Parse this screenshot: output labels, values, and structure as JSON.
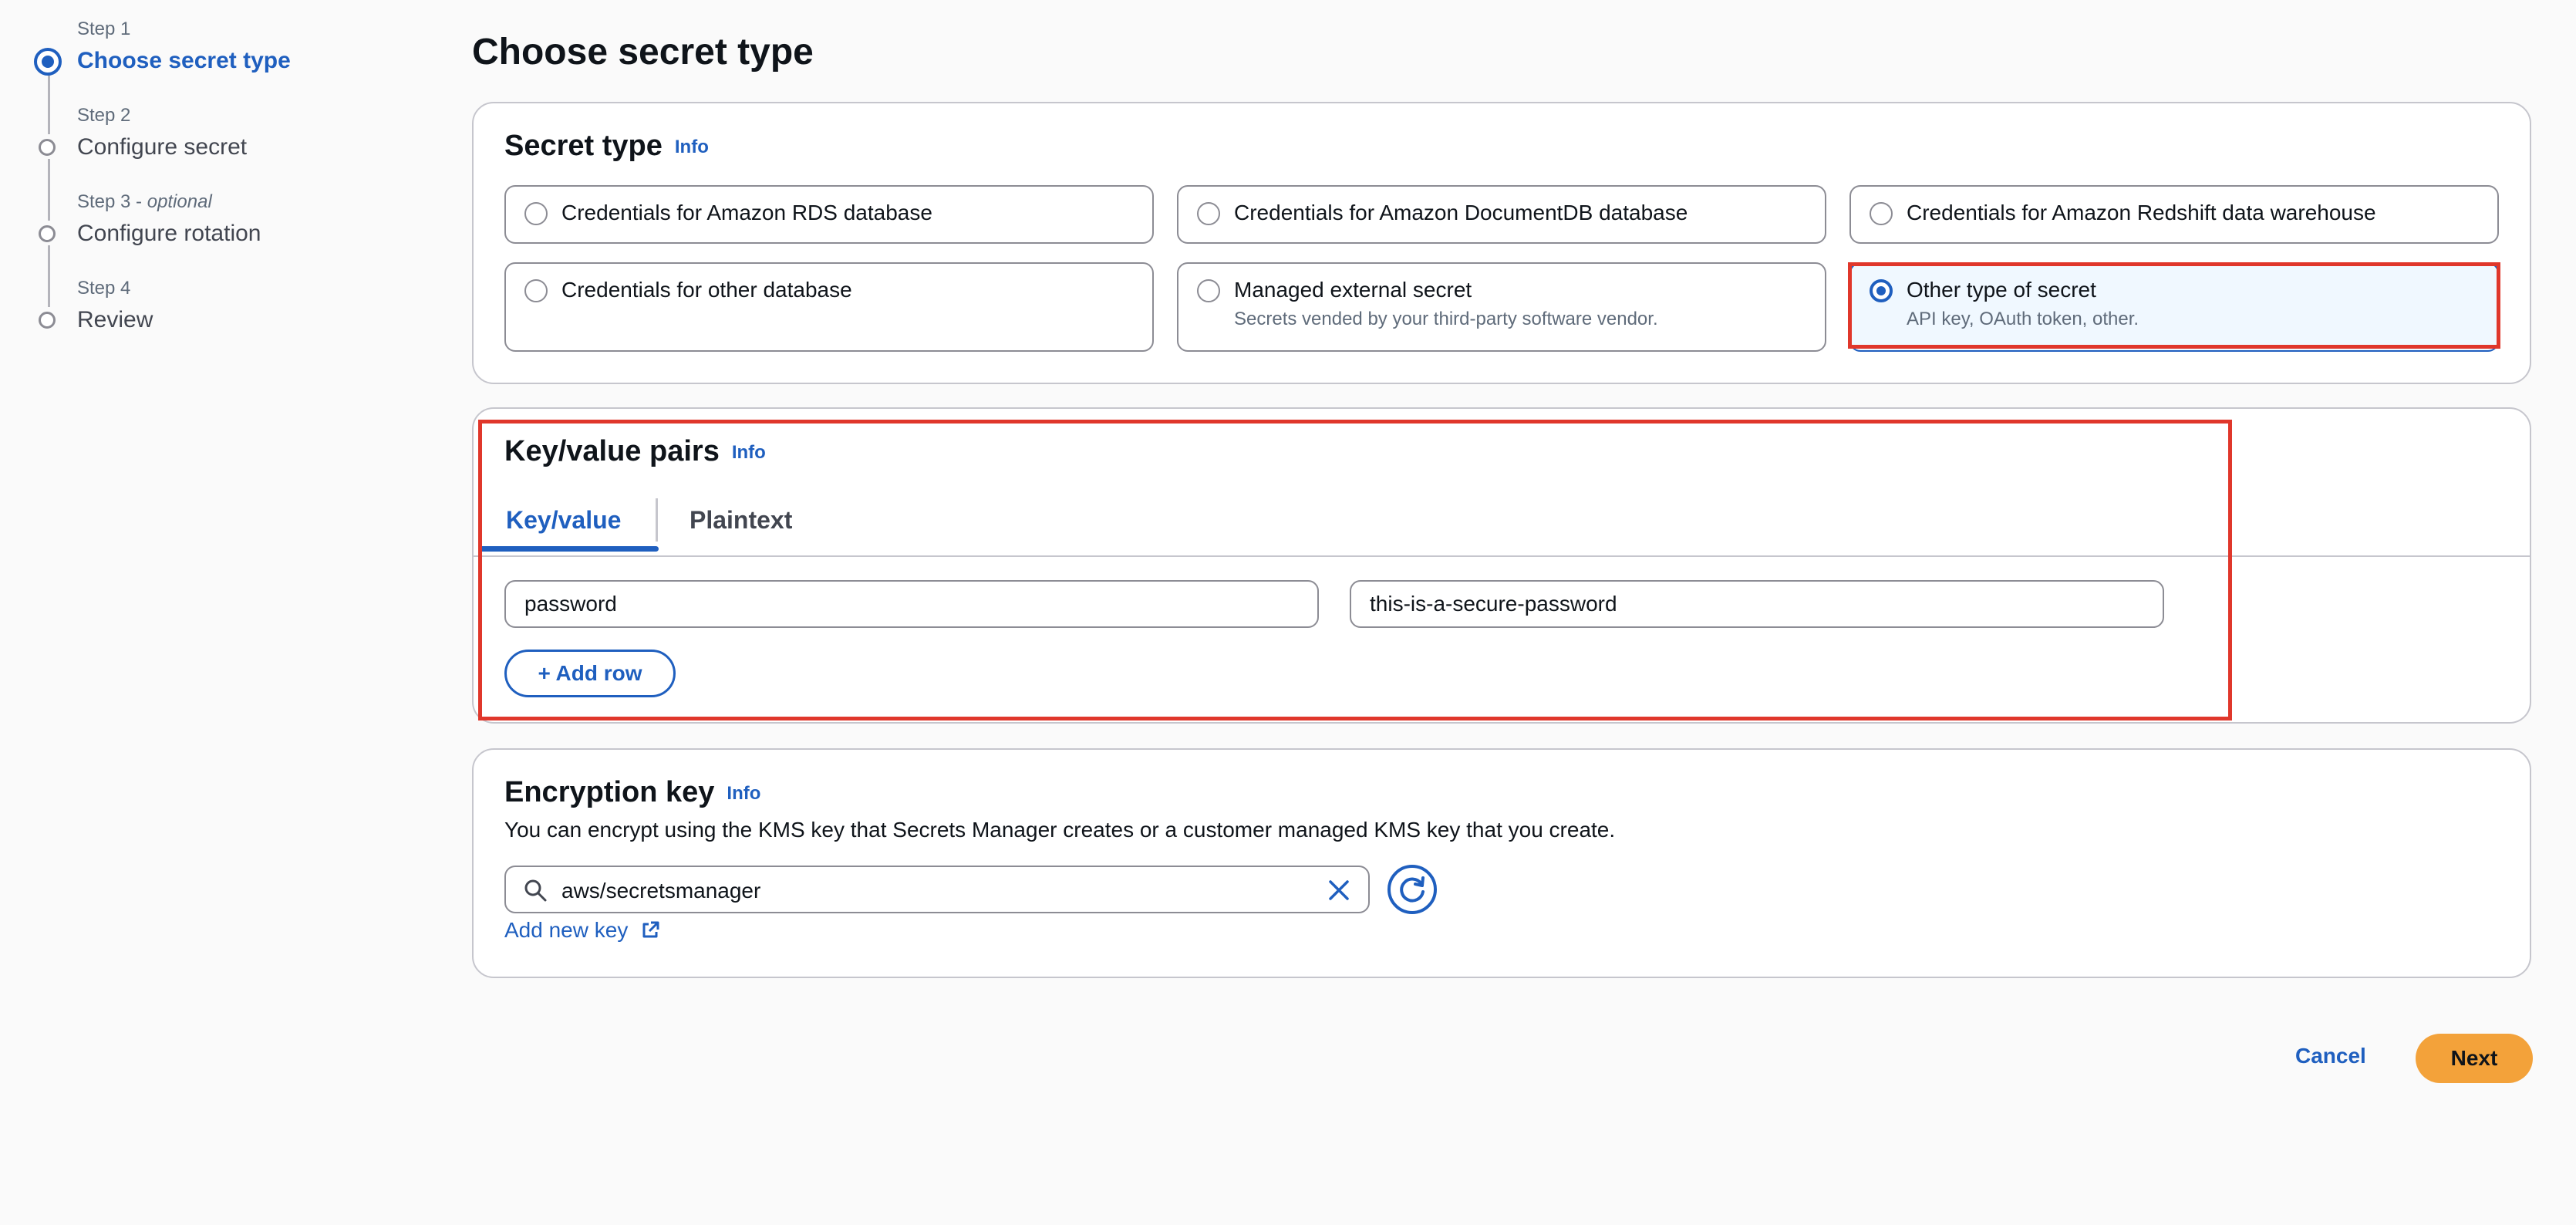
{
  "wizard": {
    "steps": [
      {
        "number": "Step 1",
        "optional": "",
        "title": "Choose secret type",
        "state": "active"
      },
      {
        "number": "Step 2",
        "optional": "",
        "title": "Configure secret",
        "state": "pending"
      },
      {
        "number": "Step 3",
        "optional": "optional",
        "title": "Configure rotation",
        "state": "pending"
      },
      {
        "number": "Step 4",
        "optional": "",
        "title": "Review",
        "state": "pending"
      }
    ],
    "optional_separator": " - "
  },
  "page": {
    "title": "Choose secret type"
  },
  "secret_type": {
    "title": "Secret type",
    "info": "Info",
    "options": [
      {
        "label": "Credentials for Amazon RDS database",
        "description": "",
        "selected": false
      },
      {
        "label": "Credentials for Amazon DocumentDB database",
        "description": "",
        "selected": false
      },
      {
        "label": "Credentials for Amazon Redshift data warehouse",
        "description": "",
        "selected": false
      },
      {
        "label": "Credentials for other database",
        "description": "",
        "selected": false
      },
      {
        "label": "Managed external secret",
        "description": "Secrets vended by your third-party software vendor.",
        "selected": false
      },
      {
        "label": "Other type of secret",
        "description": "API key, OAuth token, other.",
        "selected": true
      }
    ]
  },
  "kv_pairs": {
    "title": "Key/value pairs",
    "info": "Info",
    "tabs": [
      {
        "label": "Key/value",
        "active": true
      },
      {
        "label": "Plaintext",
        "active": false
      }
    ],
    "rows": [
      {
        "key": "password",
        "value": "this-is-a-secure-password"
      }
    ],
    "add_row_label": "+ Add row"
  },
  "encryption": {
    "title": "Encryption key",
    "info": "Info",
    "description": "You can encrypt using the KMS key that Secrets Manager creates or a customer managed KMS key that you create.",
    "selected_key": "aws/secretsmanager",
    "add_new_key_label": "Add new key"
  },
  "footer": {
    "cancel_label": "Cancel",
    "next_label": "Next"
  },
  "colors": {
    "accent": "#1f5fbf",
    "primary_button": "#f3a23a",
    "annotation_highlight": "#e0372b"
  },
  "icons": {
    "search": "search-icon",
    "clear": "close-icon",
    "refresh": "refresh-icon",
    "external": "external-link-icon"
  }
}
